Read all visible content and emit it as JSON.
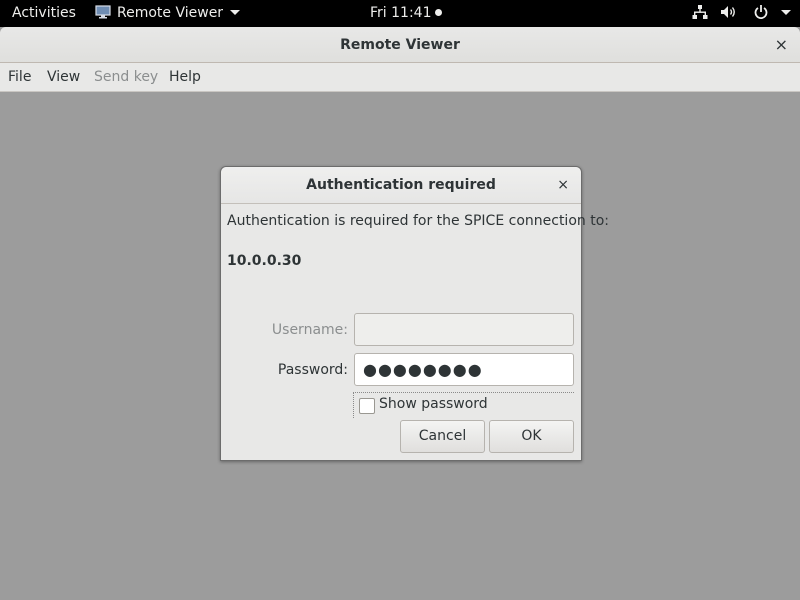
{
  "topbar": {
    "activities": "Activities",
    "app_name": "Remote Viewer",
    "clock": "Fri 11:41"
  },
  "window": {
    "title": "Remote Viewer",
    "close": "×",
    "menu": [
      "File",
      "View",
      "Send key",
      "Help"
    ]
  },
  "dialog": {
    "title": "Authentication required",
    "close": "×",
    "message": "Authentication is required for the SPICE connection to:",
    "host": "10.0.0.30",
    "username_label": "Username:",
    "username_value": "",
    "password_label": "Password:",
    "password_value": "●●●●●●●●",
    "show_password_label": "Show password",
    "show_password_checked": false,
    "cancel_label": "Cancel",
    "ok_label": "OK"
  },
  "colors": {
    "topbar_bg": "#000000",
    "window_bg": "#9c9c9c",
    "dialog_bg": "#e8e8e7"
  },
  "icons": [
    "monitor-icon",
    "network-icon",
    "volume-icon",
    "power-icon",
    "chevron-down-icon",
    "close-icon"
  ]
}
